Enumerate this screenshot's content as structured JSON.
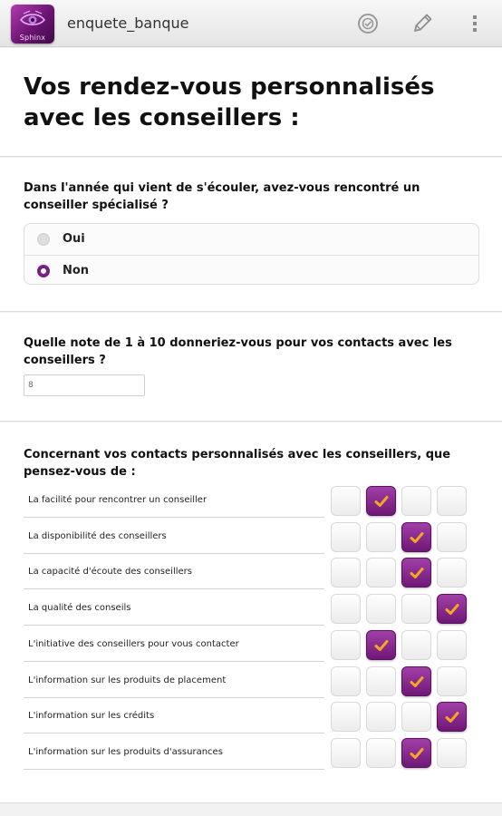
{
  "app": {
    "title": "enquete_banque",
    "icon_brand": "Sphinx",
    "icons": [
      "sphinx-eye-logo",
      "rating-badge-icon",
      "pencil-icon",
      "overflow-menu-icon"
    ]
  },
  "page_title": "Vos rendez-vous personnalisés avec les conseillers :",
  "q1": {
    "question": "Dans l'année qui vient de s'écouler, avez-vous rencontré un conseiller spécialisé ?",
    "options": [
      "Oui",
      "Non"
    ],
    "selected": "Non"
  },
  "q2": {
    "question": "Quelle note de 1 à 10 donneriez-vous pour vos contacts avec les conseillers ?",
    "value": "8"
  },
  "q3": {
    "question": "Concernant vos contacts personnalisés avec les conseillers, que pensez-vous de :",
    "rows": [
      {
        "label": "La facilité pour rencontrer un conseiller",
        "selected": 2
      },
      {
        "label": "La disponibilité des conseillers",
        "selected": 3
      },
      {
        "label": "La capacité d'écoute des conseillers",
        "selected": 3
      },
      {
        "label": "La qualité des conseils",
        "selected": 4
      },
      {
        "label": "L'initiative des conseillers pour vous contacter",
        "selected": 2
      },
      {
        "label": "L'information sur les produits de placement",
        "selected": 3
      },
      {
        "label": "L'information sur les crédits",
        "selected": 4
      },
      {
        "label": "L'information sur les produits d'assurances",
        "selected": 3
      }
    ]
  },
  "colors": {
    "accent": "#7b1e83",
    "check": "#f5a623"
  }
}
